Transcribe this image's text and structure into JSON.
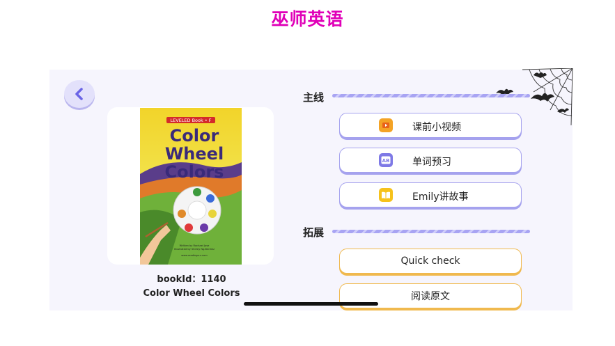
{
  "app": {
    "title": "巫师英语"
  },
  "book": {
    "id_label": "bookId：1140",
    "title": "Color Wheel Colors",
    "cover": {
      "series": "LEVELED Book • F",
      "title_lines": [
        "Color",
        "Wheel",
        "Colors"
      ],
      "credits": [
        "Written by Rachael Jose",
        "Illustrated by Shirley Ng-Benitez"
      ],
      "site": "www.readinga-z.com"
    }
  },
  "sections": {
    "main": {
      "label": "主线",
      "items": [
        {
          "label": "课前小视频",
          "icon": "video-icon"
        },
        {
          "label": "单词预习",
          "icon": "ab-word-icon"
        },
        {
          "label": "Emily讲故事",
          "icon": "book-icon"
        }
      ]
    },
    "extension": {
      "label": "拓展",
      "items": [
        {
          "label": "Quick check"
        },
        {
          "label": "阅读原文"
        }
      ]
    }
  },
  "colors": {
    "title": "#e000b8",
    "main_border": "#a5a2ee",
    "ext_border": "#f0b94e",
    "panel": "#f6f5fd"
  }
}
